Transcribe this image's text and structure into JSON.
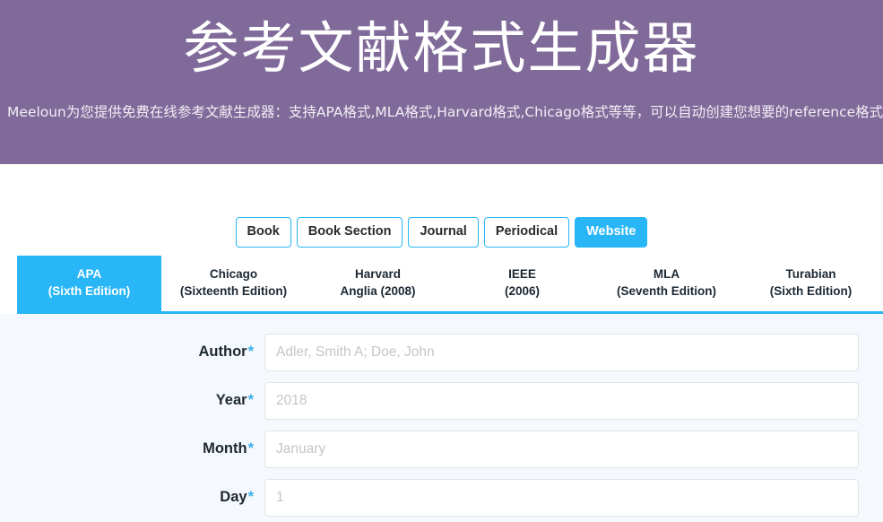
{
  "hero": {
    "title": "参考文献格式生成器",
    "subtitle": "Meeloun为您提供免费在线参考文献生成器：支持APA格式,MLA格式,Harvard格式,Chicago格式等等，可以自动创建您想要的reference格式。",
    "background_color": "#806a99"
  },
  "accent_color": "#29b6f6",
  "source_types": [
    {
      "label": "Book",
      "active": false
    },
    {
      "label": "Book Section",
      "active": false
    },
    {
      "label": "Journal",
      "active": false
    },
    {
      "label": "Periodical",
      "active": false
    },
    {
      "label": "Website",
      "active": true
    }
  ],
  "style_tabs": [
    {
      "name": "APA",
      "edition": "(Sixth Edition)",
      "active": true
    },
    {
      "name": "Chicago",
      "edition": "(Sixteenth Edition)",
      "active": false
    },
    {
      "name": "Harvard",
      "edition": "Anglia (2008)",
      "active": false
    },
    {
      "name": "IEEE",
      "edition": "(2006)",
      "active": false
    },
    {
      "name": "MLA",
      "edition": "(Seventh Edition)",
      "active": false
    },
    {
      "name": "Turabian",
      "edition": "(Sixth Edition)",
      "active": false
    }
  ],
  "form": {
    "fields": [
      {
        "label": "Author",
        "required_mark": "*",
        "placeholder": "Adler, Smith A; Doe, John",
        "value": ""
      },
      {
        "label": "Year",
        "required_mark": "*",
        "placeholder": "2018",
        "value": ""
      },
      {
        "label": "Month",
        "required_mark": "*",
        "placeholder": "January",
        "value": ""
      },
      {
        "label": "Day",
        "required_mark": "*",
        "placeholder": "1",
        "value": ""
      }
    ]
  }
}
